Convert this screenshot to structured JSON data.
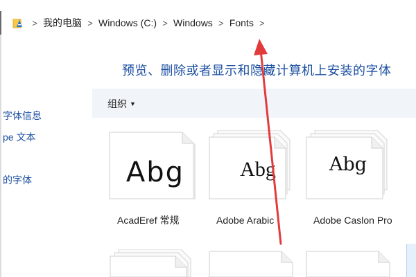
{
  "breadcrumb": {
    "items": [
      "我的电脑",
      "Windows (C:)",
      "Windows",
      "Fonts"
    ],
    "separator": ">"
  },
  "heading": "预览、删除或者显示和隐藏计算机上安装的字体",
  "left_panel": {
    "links": [
      "字体信息",
      "pe 文本",
      "的字体"
    ]
  },
  "toolbar": {
    "organize_label": "组织",
    "organize_caret": "▼"
  },
  "fonts": [
    {
      "sample": "Abg",
      "name": "AcadEref 常规"
    },
    {
      "sample": "Abg",
      "name": "Adobe Arabic"
    },
    {
      "sample": "Abg",
      "name": "Adobe Caslon Pro"
    }
  ],
  "colors": {
    "link": "#1a4ea1",
    "toolbar_bg": "#f1f4f8",
    "annotation_arrow": "#e23b3b"
  }
}
